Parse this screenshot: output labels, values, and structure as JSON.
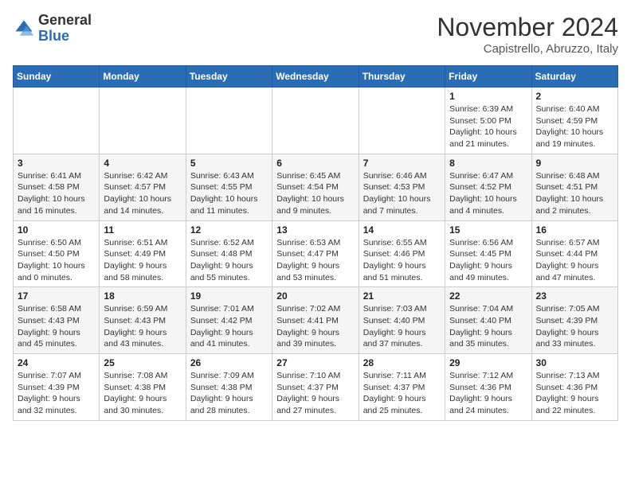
{
  "header": {
    "logo_line1": "General",
    "logo_line2": "Blue",
    "month": "November 2024",
    "location": "Capistrello, Abruzzo, Italy"
  },
  "days_of_week": [
    "Sunday",
    "Monday",
    "Tuesday",
    "Wednesday",
    "Thursday",
    "Friday",
    "Saturday"
  ],
  "weeks": [
    [
      {
        "day": "",
        "info": ""
      },
      {
        "day": "",
        "info": ""
      },
      {
        "day": "",
        "info": ""
      },
      {
        "day": "",
        "info": ""
      },
      {
        "day": "",
        "info": ""
      },
      {
        "day": "1",
        "info": "Sunrise: 6:39 AM\nSunset: 5:00 PM\nDaylight: 10 hours and 21 minutes."
      },
      {
        "day": "2",
        "info": "Sunrise: 6:40 AM\nSunset: 4:59 PM\nDaylight: 10 hours and 19 minutes."
      }
    ],
    [
      {
        "day": "3",
        "info": "Sunrise: 6:41 AM\nSunset: 4:58 PM\nDaylight: 10 hours and 16 minutes."
      },
      {
        "day": "4",
        "info": "Sunrise: 6:42 AM\nSunset: 4:57 PM\nDaylight: 10 hours and 14 minutes."
      },
      {
        "day": "5",
        "info": "Sunrise: 6:43 AM\nSunset: 4:55 PM\nDaylight: 10 hours and 11 minutes."
      },
      {
        "day": "6",
        "info": "Sunrise: 6:45 AM\nSunset: 4:54 PM\nDaylight: 10 hours and 9 minutes."
      },
      {
        "day": "7",
        "info": "Sunrise: 6:46 AM\nSunset: 4:53 PM\nDaylight: 10 hours and 7 minutes."
      },
      {
        "day": "8",
        "info": "Sunrise: 6:47 AM\nSunset: 4:52 PM\nDaylight: 10 hours and 4 minutes."
      },
      {
        "day": "9",
        "info": "Sunrise: 6:48 AM\nSunset: 4:51 PM\nDaylight: 10 hours and 2 minutes."
      }
    ],
    [
      {
        "day": "10",
        "info": "Sunrise: 6:50 AM\nSunset: 4:50 PM\nDaylight: 10 hours and 0 minutes."
      },
      {
        "day": "11",
        "info": "Sunrise: 6:51 AM\nSunset: 4:49 PM\nDaylight: 9 hours and 58 minutes."
      },
      {
        "day": "12",
        "info": "Sunrise: 6:52 AM\nSunset: 4:48 PM\nDaylight: 9 hours and 55 minutes."
      },
      {
        "day": "13",
        "info": "Sunrise: 6:53 AM\nSunset: 4:47 PM\nDaylight: 9 hours and 53 minutes."
      },
      {
        "day": "14",
        "info": "Sunrise: 6:55 AM\nSunset: 4:46 PM\nDaylight: 9 hours and 51 minutes."
      },
      {
        "day": "15",
        "info": "Sunrise: 6:56 AM\nSunset: 4:45 PM\nDaylight: 9 hours and 49 minutes."
      },
      {
        "day": "16",
        "info": "Sunrise: 6:57 AM\nSunset: 4:44 PM\nDaylight: 9 hours and 47 minutes."
      }
    ],
    [
      {
        "day": "17",
        "info": "Sunrise: 6:58 AM\nSunset: 4:43 PM\nDaylight: 9 hours and 45 minutes."
      },
      {
        "day": "18",
        "info": "Sunrise: 6:59 AM\nSunset: 4:43 PM\nDaylight: 9 hours and 43 minutes."
      },
      {
        "day": "19",
        "info": "Sunrise: 7:01 AM\nSunset: 4:42 PM\nDaylight: 9 hours and 41 minutes."
      },
      {
        "day": "20",
        "info": "Sunrise: 7:02 AM\nSunset: 4:41 PM\nDaylight: 9 hours and 39 minutes."
      },
      {
        "day": "21",
        "info": "Sunrise: 7:03 AM\nSunset: 4:40 PM\nDaylight: 9 hours and 37 minutes."
      },
      {
        "day": "22",
        "info": "Sunrise: 7:04 AM\nSunset: 4:40 PM\nDaylight: 9 hours and 35 minutes."
      },
      {
        "day": "23",
        "info": "Sunrise: 7:05 AM\nSunset: 4:39 PM\nDaylight: 9 hours and 33 minutes."
      }
    ],
    [
      {
        "day": "24",
        "info": "Sunrise: 7:07 AM\nSunset: 4:39 PM\nDaylight: 9 hours and 32 minutes."
      },
      {
        "day": "25",
        "info": "Sunrise: 7:08 AM\nSunset: 4:38 PM\nDaylight: 9 hours and 30 minutes."
      },
      {
        "day": "26",
        "info": "Sunrise: 7:09 AM\nSunset: 4:38 PM\nDaylight: 9 hours and 28 minutes."
      },
      {
        "day": "27",
        "info": "Sunrise: 7:10 AM\nSunset: 4:37 PM\nDaylight: 9 hours and 27 minutes."
      },
      {
        "day": "28",
        "info": "Sunrise: 7:11 AM\nSunset: 4:37 PM\nDaylight: 9 hours and 25 minutes."
      },
      {
        "day": "29",
        "info": "Sunrise: 7:12 AM\nSunset: 4:36 PM\nDaylight: 9 hours and 24 minutes."
      },
      {
        "day": "30",
        "info": "Sunrise: 7:13 AM\nSunset: 4:36 PM\nDaylight: 9 hours and 22 minutes."
      }
    ]
  ]
}
